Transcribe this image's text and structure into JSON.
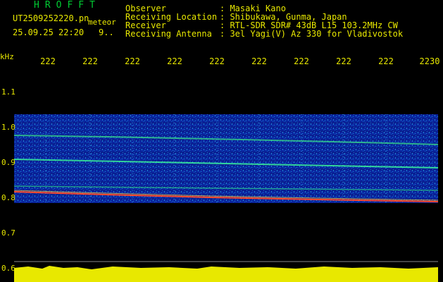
{
  "header": {
    "brand": "HROFFT",
    "filename": "UT2509252220.pn",
    "meteor_label": "meteor",
    "timestamp": "25.09.25 22:20",
    "counter": "9..",
    "fields": [
      {
        "key": "Observer",
        "value": ": Masaki Kano"
      },
      {
        "key": "Receiving Location",
        "value": ": Shibukawa, Gunma, Japan"
      },
      {
        "key": "Receiver",
        "value": ": RTL-SDR SDR# 43dB L15 103.2MHz CW"
      },
      {
        "key": "Receiving Antenna",
        "value": ": 3el Yagi(V) Az 330 for Vladivostok"
      }
    ]
  },
  "axes": {
    "unit": "kHz",
    "time_ticks": [
      "222",
      "222",
      "222",
      "222",
      "222",
      "222",
      "222",
      "222",
      "222",
      "2230"
    ],
    "freq_ticks": [
      "1.1",
      "1.0",
      "0.9",
      "0.8",
      "0.7",
      "0.6"
    ]
  },
  "colors": {
    "text": "#e8e800",
    "brand": "#00cc33",
    "background": "#000000",
    "spectrum_low": "#0a1a8c",
    "spectrum_mid": "#1f9fd8",
    "spectrum_high": "#ff3b1f"
  }
}
